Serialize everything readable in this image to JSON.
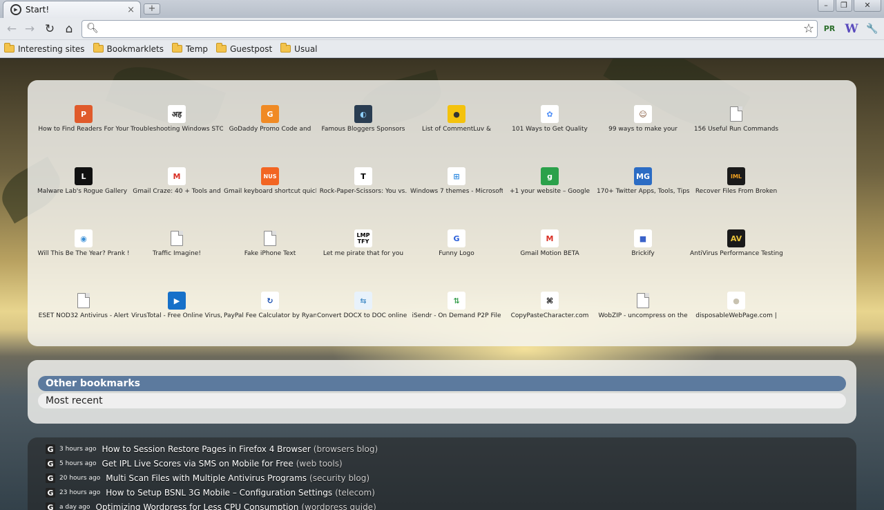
{
  "tab": {
    "title": "Start!",
    "close": "×",
    "new_tab": "+"
  },
  "window_controls": {
    "minimize": "–",
    "restore": "❐",
    "close": "✕"
  },
  "toolbar": {
    "back": "←",
    "forward": "→",
    "reload": "↻",
    "home": "⌂",
    "address_value": "",
    "address_placeholder": "",
    "star": "☆",
    "ext_pr": "PR",
    "ext_w": "W",
    "wrench": "🔧"
  },
  "bookmarks_bar": [
    "Interesting sites",
    "Bookmarklets",
    "Temp",
    "Guestpost",
    "Usual"
  ],
  "thumbnails": [
    {
      "label": "How to Find Readers For Your",
      "icon": "circle-p-icon",
      "glyph": "P",
      "bg": "#e05a2b",
      "fg": "#ffffff"
    },
    {
      "label": "Troubleshooting Windows STOP",
      "icon": "hindi-icon",
      "glyph": "अह",
      "bg": "#ffffff",
      "fg": "#222222"
    },
    {
      "label": "GoDaddy Promo Code and",
      "icon": "godaddy-icon",
      "glyph": "G",
      "bg": "#f08a24",
      "fg": "#ffffff"
    },
    {
      "label": "Famous Bloggers Sponsors",
      "icon": "globe-icon",
      "glyph": "◐",
      "bg": "#2a3d52",
      "fg": "#8fd0ff"
    },
    {
      "label": "List of CommentLuv &",
      "icon": "commentluv-icon",
      "glyph": "●",
      "bg": "#f4c20d",
      "fg": "#333333"
    },
    {
      "label": "101 Ways to Get Quality",
      "icon": "flower-icon",
      "glyph": "✿",
      "bg": "#ffffff",
      "fg": "#4e8ef7"
    },
    {
      "label": "99 ways to make your",
      "icon": "character-icon",
      "glyph": "☺",
      "bg": "#ffffff",
      "fg": "#7a4a2a"
    },
    {
      "label": "156 Useful Run Commands",
      "icon": "document-icon",
      "glyph": "",
      "bg": "",
      "fg": ""
    },
    {
      "label": "Malware Lab's Rogue Gallery |",
      "icon": "l-logo-icon",
      "glyph": "L",
      "bg": "#111111",
      "fg": "#ffffff"
    },
    {
      "label": "Gmail Craze: 40 + Tools and",
      "icon": "gmail-icon",
      "glyph": "M",
      "bg": "#ffffff",
      "fg": "#d93025"
    },
    {
      "label": "Gmail keyboard shortcut quick",
      "icon": "nus-icon",
      "glyph": "NUS",
      "bg": "#f26522",
      "fg": "#ffffff"
    },
    {
      "label": "Rock-Paper-Scissors: You vs.",
      "icon": "nyt-icon",
      "glyph": "T",
      "bg": "#ffffff",
      "fg": "#000000"
    },
    {
      "label": "Windows 7 themes - Microsoft",
      "icon": "windows-icon",
      "glyph": "⊞",
      "bg": "#ffffff",
      "fg": "#2f8ae0"
    },
    {
      "label": "+1 your website – Google",
      "icon": "google-icon",
      "glyph": "g",
      "bg": "#2ba14a",
      "fg": "#ffffff"
    },
    {
      "label": "170+ Twitter Apps, Tools, Tips",
      "icon": "mg-icon",
      "glyph": "MG",
      "bg": "#2b6cc4",
      "fg": "#ffffff"
    },
    {
      "label": "Recover Files From Broken",
      "icon": "iml-icon",
      "glyph": "IML",
      "bg": "#1a1a1a",
      "fg": "#f0a020"
    },
    {
      "label": "Will This Be The Year? Prank !",
      "icon": "oval-logo-icon",
      "glyph": "◉",
      "bg": "#ffffff",
      "fg": "#3a8fd6"
    },
    {
      "label": "Traffic Imagine!",
      "icon": "document-icon",
      "glyph": "",
      "bg": "",
      "fg": ""
    },
    {
      "label": "Fake iPhone Text",
      "icon": "document-icon",
      "glyph": "",
      "bg": "",
      "fg": ""
    },
    {
      "label": "Let me pirate that for you",
      "icon": "lmptfy-icon",
      "glyph": "LMP TFY",
      "bg": "#ffffff",
      "fg": "#000000"
    },
    {
      "label": "Funny Logo",
      "icon": "g-logo-icon",
      "glyph": "G",
      "bg": "#ffffff",
      "fg": "#2b5fd9"
    },
    {
      "label": "Gmail Motion BETA",
      "icon": "gmail-icon",
      "glyph": "M",
      "bg": "#ffffff",
      "fg": "#d93025"
    },
    {
      "label": "Brickify",
      "icon": "cube-icon",
      "glyph": "■",
      "bg": "#ffffff",
      "fg": "#3b63c9"
    },
    {
      "label": "AntiVirus Performance Testing",
      "icon": "av-icon",
      "glyph": "AV",
      "bg": "#1a1a1a",
      "fg": "#e8c23a"
    },
    {
      "label": "ESET NOD32 Antivirus - Alert",
      "icon": "document-icon",
      "glyph": "",
      "bg": "",
      "fg": ""
    },
    {
      "label": "VirusTotal - Free Online Virus,",
      "icon": "virustotal-icon",
      "glyph": "▶",
      "bg": "#1670c9",
      "fg": "#ffffff"
    },
    {
      "label": "PayPal Fee Calculator by Ryan",
      "icon": "refresh-icon",
      "glyph": "↻",
      "bg": "#ffffff",
      "fg": "#1a4fb0"
    },
    {
      "label": "Convert DOCX to DOC online |",
      "icon": "convert-icon",
      "glyph": "⇆",
      "bg": "#e8f2fb",
      "fg": "#4a90c8"
    },
    {
      "label": "iSendr - On Demand P2P File",
      "icon": "arrows-icon",
      "glyph": "⇅",
      "bg": "#ffffff",
      "fg": "#3aa050"
    },
    {
      "label": "CopyPasteCharacter.com",
      "icon": "command-icon",
      "glyph": "⌘",
      "bg": "#ffffff",
      "fg": "#000000"
    },
    {
      "label": "WobZIP - uncompress on the",
      "icon": "document-icon",
      "glyph": "",
      "bg": "",
      "fg": ""
    },
    {
      "label": "disposableWebPage.com |",
      "icon": "ball-icon",
      "glyph": "●",
      "bg": "#ffffff",
      "fg": "#c8c2b0"
    }
  ],
  "bookmark_sections": {
    "active": "Other bookmarks",
    "second": "Most recent"
  },
  "feed": [
    {
      "time": "3 hours ago",
      "title": "How to Session Restore Pages in Firefox 4 Browser",
      "category": "(browsers blog)"
    },
    {
      "time": "5 hours ago",
      "title": "Get IPL Live Scores via SMS on Mobile for Free",
      "category": "(web tools)"
    },
    {
      "time": "20 hours ago",
      "title": "Multi Scan Files with Multiple Antivirus Programs",
      "category": "(security blog)"
    },
    {
      "time": "23 hours ago",
      "title": "How to Setup BSNL 3G Mobile – Configuration Settings",
      "category": "(telecom)"
    },
    {
      "time": "a day ago",
      "title": "Optimizing Wordpress for Less CPU Consumption",
      "category": "(wordpress guide)"
    }
  ],
  "feed_icon_glyph": "G",
  "colors": {
    "accent_bar": "#5c7a9e",
    "tab_bg": "#f5f7fa",
    "toolbar_bg": "#e7eaee"
  }
}
